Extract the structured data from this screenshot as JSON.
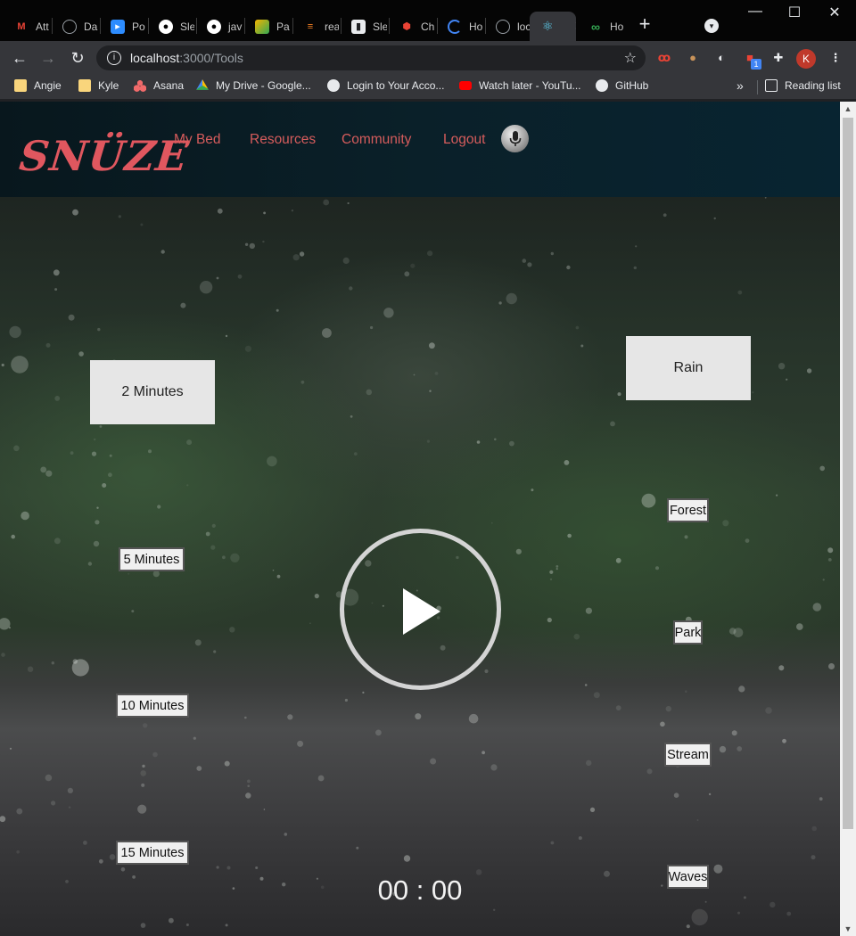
{
  "browser": {
    "tabs": [
      {
        "label": "Att",
        "icon": "gmail-icon",
        "color": "#ea4335"
      },
      {
        "label": "Da",
        "icon": "globe-icon",
        "color": "#5f6368"
      },
      {
        "label": "Po",
        "icon": "zoom-icon",
        "color": "#2d8cff"
      },
      {
        "label": "Sle",
        "icon": "github-icon",
        "color": "#ffffff"
      },
      {
        "label": "jav",
        "icon": "github-icon",
        "color": "#ffffff"
      },
      {
        "label": "Pa",
        "icon": "palette-icon",
        "color": "#f4b400"
      },
      {
        "label": "rea",
        "icon": "stackoverflow-icon",
        "color": "#f48024"
      },
      {
        "label": "Sle",
        "icon": "book-icon",
        "color": "#e8eaed"
      },
      {
        "label": "Ch",
        "icon": "cube-icon",
        "color": "#ea4335"
      },
      {
        "label": "Ho",
        "icon": "spinner-icon",
        "color": "#4285f4"
      },
      {
        "label": "loc",
        "icon": "globe-icon",
        "color": "#5f6368"
      },
      {
        "label": "",
        "icon": "react-icon",
        "color": "#61dafb"
      },
      {
        "label": "Ho",
        "icon": "infinity-icon",
        "color": "#34a853"
      }
    ],
    "url_host": "localhost",
    "url_path": ":3000/Tools",
    "profile_initial": "K",
    "extension_badge": "1",
    "bookmarks": [
      {
        "label": "Angie",
        "icon": "folder-icon"
      },
      {
        "label": "Kyle",
        "icon": "folder-icon"
      },
      {
        "label": "Asana",
        "icon": "asana-icon"
      },
      {
        "label": "My Drive - Google...",
        "icon": "drive-icon"
      },
      {
        "label": "Login to Your Acco...",
        "icon": "globe-icon"
      },
      {
        "label": "Watch later - YouTu...",
        "icon": "youtube-icon"
      },
      {
        "label": "GitHub",
        "icon": "github-icon"
      }
    ],
    "reading_list": "Reading list"
  },
  "app": {
    "logo": "SNÜZE",
    "nav": [
      "My Bed",
      "Resources",
      "Community",
      "Logout"
    ],
    "accent": "#d65c5c"
  },
  "tools": {
    "selected_duration": "2 Minutes",
    "selected_sound": "Rain",
    "durations": [
      "5 Minutes",
      "10 Minutes",
      "15 Minutes"
    ],
    "sounds": [
      "Forest",
      "Park",
      "Stream",
      "Waves"
    ],
    "timer": "00 : 00"
  }
}
